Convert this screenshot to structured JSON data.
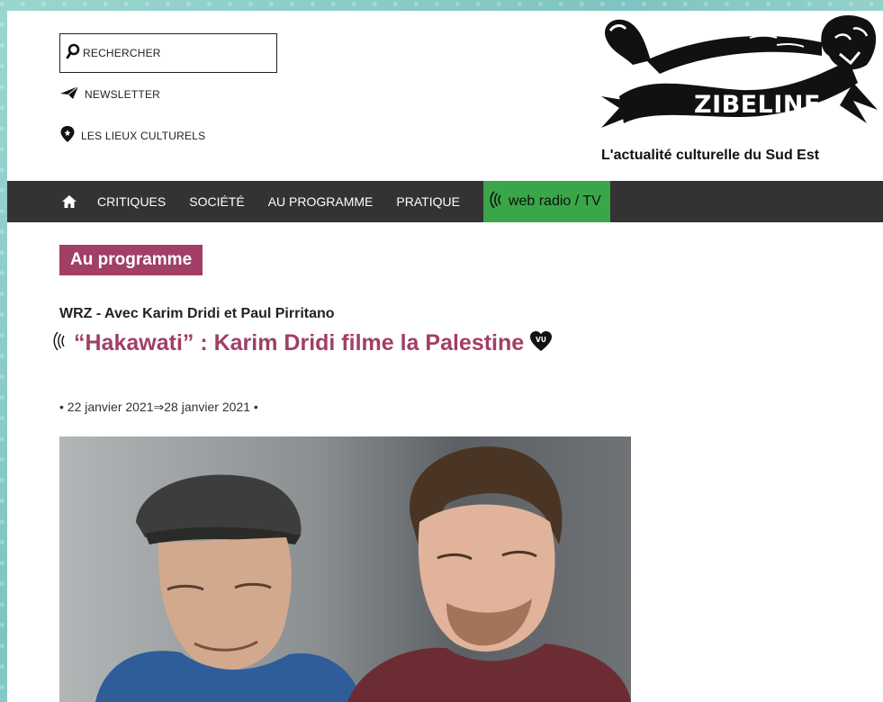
{
  "header": {
    "search_label": "RECHERCHER",
    "newsletter_label": "NEWSLETTER",
    "places_label": "LES LIEUX CULTURELS",
    "logo_text": "ZIBELINE",
    "tagline": "L'actualité culturelle du Sud Est"
  },
  "nav": {
    "items": [
      "CRITIQUES",
      "SOCIÉTÉ",
      "AU PROGRAMME",
      "PRATIQUE"
    ],
    "radio_label": "web radio / TV"
  },
  "article": {
    "section": "Au programme",
    "kicker": "WRZ - Avec Karim Dridi et Paul Pirritano",
    "title": "“Hakawati” : Karim Dridi filme la Palestine",
    "badge": "VU",
    "dates": "• 22 janvier 2021⇒28 janvier 2021 •"
  },
  "colors": {
    "accent": "#a13f66",
    "nav_bg": "#333333",
    "radio_bg": "#3aa64a",
    "page_bg": "#8ccfca"
  }
}
